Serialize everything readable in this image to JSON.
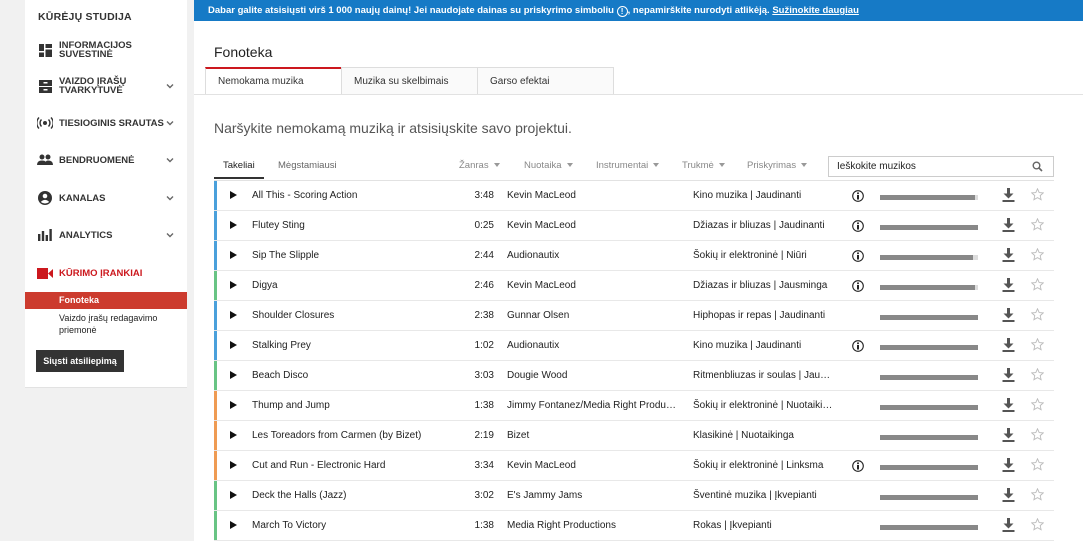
{
  "sidebar": {
    "title": "KŪRĖJŲ STUDIJA",
    "items": [
      {
        "label1": "INFORMACIJOS",
        "label2": "SUVESTINĖ",
        "icon": "dashboard-icon"
      },
      {
        "label1": "VAIZDO ĮRAŠŲ",
        "label2": "TVARKYTUVĖ",
        "icon": "video-manager-icon"
      },
      {
        "label1": "TIESIOGINIS SRAUTAS",
        "label2": "",
        "icon": "live-icon"
      },
      {
        "label1": "BENDRUOMENĖ",
        "label2": "",
        "icon": "community-icon"
      },
      {
        "label1": "KANALAS",
        "label2": "",
        "icon": "channel-icon"
      },
      {
        "label1": "ANALYTICS",
        "label2": "",
        "icon": "analytics-icon"
      },
      {
        "label1": "KŪRIMO ĮRANKIAI",
        "label2": "",
        "icon": "create-icon"
      }
    ],
    "sub_fonoteka": "Fonoteka",
    "sub_editor_1": "Vaizdo įrašų redagavimo",
    "sub_editor_2": "priemonė",
    "feedback": "Siųsti atsiliepimą"
  },
  "banner": {
    "text_a": "Dabar galite atsisiųsti virš 1 000 naujų dainų! Jei naudojate dainas su priskyrimo simboliu ",
    "text_b": ", nepamirškite nurodyti atlikėją. ",
    "link": "Sužinokite daugiau"
  },
  "page": {
    "title": "Fonoteka",
    "tabs": [
      "Nemokama muzika",
      "Muzika su skelbimais",
      "Garso efektai"
    ],
    "subtitle": "Naršykite nemokamą muziką ir atsisiųskite savo projektui."
  },
  "filters": {
    "tab_tracks": "Takeliai",
    "tab_favorites": "Mėgstamiausi",
    "genre": "Žanras",
    "mood": "Nuotaika",
    "instrument": "Instrumentai",
    "duration": "Trukmė",
    "attribution": "Priskyrimas",
    "search_placeholder": "Ieškokite muzikos"
  },
  "colors": {
    "accent_red": "#cc181e",
    "banner_blue": "#167ac6",
    "row_blue": "#4aa0db",
    "row_green": "#68c484",
    "row_orange": "#ef9b53"
  },
  "tracks": [
    {
      "title": "All This - Scoring Action",
      "duration": "3:48",
      "artist": "Kevin MacLeod",
      "genre": "Kino muzika | Jaudinanti",
      "attribution": true,
      "popularity": 0.97,
      "accent": "blue"
    },
    {
      "title": "Flutey Sting",
      "duration": "0:25",
      "artist": "Kevin MacLeod",
      "genre": "Džiazas ir bliuzas | Jaudinanti",
      "attribution": true,
      "popularity": 1.0,
      "accent": "blue"
    },
    {
      "title": "Sip The Slipple",
      "duration": "2:44",
      "artist": "Audionautix",
      "genre": "Šokių ir elektroninė | Niūri",
      "attribution": true,
      "popularity": 0.95,
      "accent": "blue"
    },
    {
      "title": "Digya",
      "duration": "2:46",
      "artist": "Kevin MacLeod",
      "genre": "Džiazas ir bliuzas | Jausminga",
      "attribution": true,
      "popularity": 0.97,
      "accent": "green"
    },
    {
      "title": "Shoulder Closures",
      "duration": "2:38",
      "artist": "Gunnar Olsen",
      "genre": "Hiphopas ir repas | Jaudinanti",
      "attribution": false,
      "popularity": 1.0,
      "accent": "blue"
    },
    {
      "title": "Stalking Prey",
      "duration": "1:02",
      "artist": "Audionautix",
      "genre": "Kino muzika | Jaudinanti",
      "attribution": true,
      "popularity": 1.0,
      "accent": "blue"
    },
    {
      "title": "Beach Disco",
      "duration": "3:03",
      "artist": "Dougie Wood",
      "genre": "Ritmenbliuzas ir soulas | Jaus...",
      "attribution": false,
      "popularity": 1.0,
      "accent": "green"
    },
    {
      "title": "Thump and Jump",
      "duration": "1:38",
      "artist": "Jimmy Fontanez/Media Right Produc...",
      "genre": "Šokių ir elektroninė | Nuotaikinga",
      "attribution": false,
      "popularity": 1.0,
      "accent": "orange"
    },
    {
      "title": "Les Toreadors from Carmen (by Bizet)",
      "duration": "2:19",
      "artist": "Bizet",
      "genre": "Klasikinė | Nuotaikinga",
      "attribution": false,
      "popularity": 1.0,
      "accent": "orange"
    },
    {
      "title": "Cut and Run - Electronic Hard",
      "duration": "3:34",
      "artist": "Kevin MacLeod",
      "genre": "Šokių ir elektroninė | Linksma",
      "attribution": true,
      "popularity": 1.0,
      "accent": "orange"
    },
    {
      "title": "Deck the Halls (Jazz)",
      "duration": "3:02",
      "artist": "E's Jammy Jams",
      "genre": "Šventinė muzika | Įkvepianti",
      "attribution": false,
      "popularity": 1.0,
      "accent": "green"
    },
    {
      "title": "March To Victory",
      "duration": "1:38",
      "artist": "Media Right Productions",
      "genre": "Rokas | Įkvepianti",
      "attribution": false,
      "popularity": 1.0,
      "accent": "green"
    }
  ]
}
